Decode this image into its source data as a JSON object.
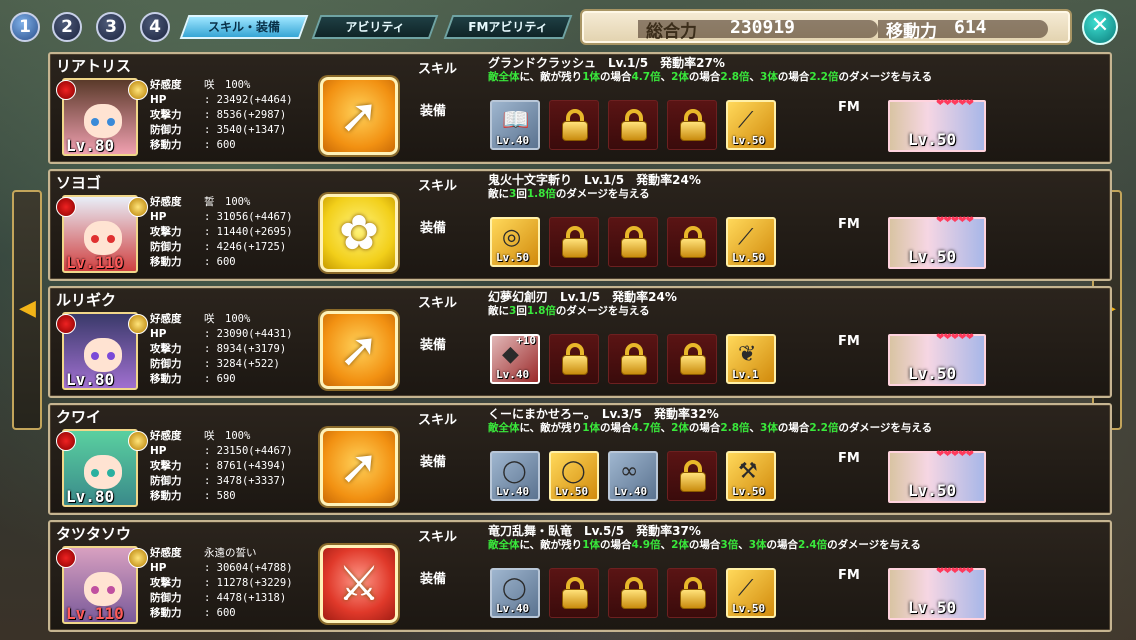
{
  "party_tabs": [
    "1",
    "2",
    "3",
    "4"
  ],
  "tabs": [
    {
      "label": "スキル・装備",
      "active": true
    },
    {
      "label": "アビリティ",
      "active": false
    },
    {
      "label": "FMアビリティ",
      "active": false
    }
  ],
  "power": {
    "total_label": "総合力",
    "total_value": "230919",
    "move_label": "移動力",
    "move_value": "614"
  },
  "labels": {
    "skill": "スキル",
    "equip": "装備",
    "fm": "FM"
  },
  "characters": [
    {
      "name": "リアトリス",
      "level": "Lv.80",
      "level_red": false,
      "affection": "咲　100%",
      "hp": "23492(+4464)",
      "atk": "8536(+2987)",
      "def": "3540(+1347)",
      "move": "600",
      "skill_title": "グランドクラッシュ　Lv.1/5　発動率27%",
      "skill_desc": [
        {
          "t": "敵全体",
          "g": true
        },
        {
          "t": "に、敵が残り",
          "g": false
        },
        {
          "t": "1体",
          "g": true
        },
        {
          "t": "の場合",
          "g": false
        },
        {
          "t": "4.7倍",
          "g": true
        },
        {
          "t": "、",
          "g": false
        },
        {
          "t": "2体",
          "g": true
        },
        {
          "t": "の場合",
          "g": false
        },
        {
          "t": "2.8倍",
          "g": true
        },
        {
          "t": "、",
          "g": false
        },
        {
          "t": "3体",
          "g": true
        },
        {
          "t": "の場合",
          "g": false
        },
        {
          "t": "2.2倍",
          "g": true
        },
        {
          "t": "のダメージを与える",
          "g": false
        }
      ],
      "skill_color": "orange",
      "skill_icon": "arrow-up-icon",
      "equipment": [
        {
          "type": "item",
          "style": "silver",
          "icon": "book-icon",
          "level": "Lv.40",
          "plus": ""
        },
        {
          "type": "lock"
        },
        {
          "type": "lock"
        },
        {
          "type": "lock"
        },
        {
          "type": "item",
          "style": "gold",
          "icon": "spear-icon",
          "level": "Lv.50",
          "plus": ""
        }
      ],
      "fm_level": "Lv.50"
    },
    {
      "name": "ソヨゴ",
      "level": "Lv.110",
      "level_red": true,
      "affection": "誓　100%",
      "hp": "31056(+4467)",
      "atk": "11440(+2695)",
      "def": "4246(+1725)",
      "move": "600",
      "skill_title": "鬼火十文字斬り　Lv.1/5　発動率24%",
      "skill_desc": [
        {
          "t": "敵に",
          "g": false
        },
        {
          "t": "3",
          "g": true
        },
        {
          "t": "回",
          "g": false
        },
        {
          "t": "1.8倍",
          "g": true
        },
        {
          "t": "のダメージを与える",
          "g": false
        }
      ],
      "skill_color": "yellow",
      "skill_icon": "flower-icon",
      "equipment": [
        {
          "type": "item",
          "style": "gold",
          "icon": "bracelet-icon",
          "level": "Lv.50",
          "plus": ""
        },
        {
          "type": "lock"
        },
        {
          "type": "lock"
        },
        {
          "type": "lock"
        },
        {
          "type": "item",
          "style": "gold",
          "icon": "spear-icon",
          "level": "Lv.50",
          "plus": ""
        }
      ],
      "fm_level": "Lv.50"
    },
    {
      "name": "ルリギク",
      "level": "Lv.80",
      "level_red": false,
      "affection": "咲　100%",
      "hp": "23090(+4431)",
      "atk": "8934(+3179)",
      "def": "3284(+522)",
      "move": "690",
      "skill_title": "幻夢幻創刃　Lv.1/5　発動率24%",
      "skill_desc": [
        {
          "t": "敵に",
          "g": false
        },
        {
          "t": "3",
          "g": true
        },
        {
          "t": "回",
          "g": false
        },
        {
          "t": "1.8倍",
          "g": true
        },
        {
          "t": "のダメージを与える",
          "g": false
        }
      ],
      "skill_color": "orange",
      "skill_icon": "arrow-up-icon",
      "equipment": [
        {
          "type": "item",
          "style": "red",
          "icon": "gem-icon",
          "level": "Lv.40",
          "plus": "+10"
        },
        {
          "type": "lock"
        },
        {
          "type": "lock"
        },
        {
          "type": "lock"
        },
        {
          "type": "item",
          "style": "gold",
          "icon": "feather-icon",
          "level": "Lv.1",
          "plus": ""
        }
      ],
      "fm_level": "Lv.50"
    },
    {
      "name": "クワイ",
      "level": "Lv.80",
      "level_red": false,
      "affection": "咲　100%",
      "hp": "23150(+4467)",
      "atk": "8761(+4394)",
      "def": "3478(+3337)",
      "move": "580",
      "skill_title": "くーにまかせろー。　Lv.3/5　発動率32%",
      "skill_desc": [
        {
          "t": "敵全体",
          "g": true
        },
        {
          "t": "に、敵が残り",
          "g": false
        },
        {
          "t": "1体",
          "g": true
        },
        {
          "t": "の場合",
          "g": false
        },
        {
          "t": "4.7倍",
          "g": true
        },
        {
          "t": "、",
          "g": false
        },
        {
          "t": "2体",
          "g": true
        },
        {
          "t": "の場合",
          "g": false
        },
        {
          "t": "2.8倍",
          "g": true
        },
        {
          "t": "、",
          "g": false
        },
        {
          "t": "3体",
          "g": true
        },
        {
          "t": "の場合",
          "g": false
        },
        {
          "t": "2.2倍",
          "g": true
        },
        {
          "t": "のダメージを与える",
          "g": false
        }
      ],
      "skill_color": "orange",
      "skill_icon": "arrow-up-icon",
      "equipment": [
        {
          "type": "item",
          "style": "silver",
          "icon": "ring-icon",
          "level": "Lv.40",
          "plus": ""
        },
        {
          "type": "item",
          "style": "gold",
          "icon": "ring-icon",
          "level": "Lv.50",
          "plus": ""
        },
        {
          "type": "item",
          "style": "silver",
          "icon": "earring-icon",
          "level": "Lv.40",
          "plus": ""
        },
        {
          "type": "lock"
        },
        {
          "type": "item",
          "style": "gold",
          "icon": "axe-icon",
          "level": "Lv.50",
          "plus": ""
        }
      ],
      "fm_level": "Lv.50"
    },
    {
      "name": "タツタソウ",
      "level": "Lv.110",
      "level_red": true,
      "affection": "永遠の誓い",
      "hp": "30604(+4788)",
      "atk": "11278(+3229)",
      "def": "4478(+1318)",
      "move": "600",
      "skill_title": "竜刀乱舞・臥竜　Lv.5/5　発動率37%",
      "skill_desc": [
        {
          "t": "敵全体",
          "g": true
        },
        {
          "t": "に、敵が残り",
          "g": false
        },
        {
          "t": "1体",
          "g": true
        },
        {
          "t": "の場合",
          "g": false
        },
        {
          "t": "4.9倍",
          "g": true
        },
        {
          "t": "、",
          "g": false
        },
        {
          "t": "2体",
          "g": true
        },
        {
          "t": "の場合",
          "g": false
        },
        {
          "t": "3倍",
          "g": true
        },
        {
          "t": "、",
          "g": false
        },
        {
          "t": "3体",
          "g": true
        },
        {
          "t": "の場合",
          "g": false
        },
        {
          "t": "2.4倍",
          "g": true
        },
        {
          "t": "のダメージを与える",
          "g": false
        }
      ],
      "skill_color": "red",
      "skill_icon": "sword-icon",
      "equipment": [
        {
          "type": "item",
          "style": "silver",
          "icon": "ring-icon",
          "level": "Lv.40",
          "plus": ""
        },
        {
          "type": "lock"
        },
        {
          "type": "lock"
        },
        {
          "type": "lock"
        },
        {
          "type": "item",
          "style": "gold",
          "icon": "staff-icon",
          "level": "Lv.50",
          "plus": ""
        }
      ],
      "fm_level": "Lv.50"
    }
  ],
  "stat_labels": {
    "affection": "好感度",
    "hp": "HP",
    "atk": "攻撃力",
    "def": "防御力",
    "move": "移動力"
  },
  "colors": {
    "accent": "#c6b591",
    "green_text": "#39e83b",
    "lock_bg": "#5a1414",
    "close_button": "#17a9a3"
  }
}
